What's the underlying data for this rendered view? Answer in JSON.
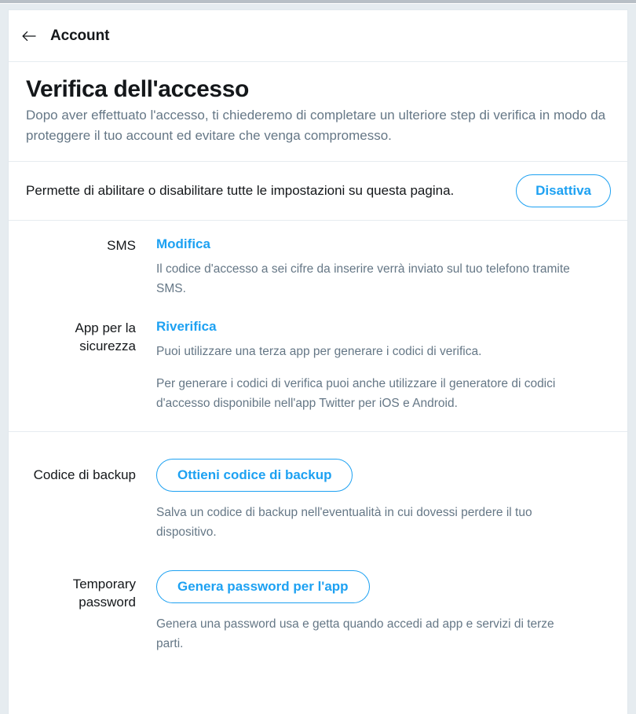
{
  "header": {
    "back_icon": "arrow-left-icon",
    "title": "Account"
  },
  "intro": {
    "title": "Verifica dell'accesso",
    "description": "Dopo aver effettuato l'accesso, ti chiederemo di completare un ulteriore step di verifica in modo da proteggere il tuo account ed evitare che venga compromesso."
  },
  "master": {
    "text": "Permette di abilitare o disabilitare tutte le impostazioni su questa pagina.",
    "button_label": "Disattiva"
  },
  "settings": [
    {
      "label": "SMS",
      "action_type": "link",
      "action_label": "Modifica",
      "descriptions": [
        "Il codice d'accesso a sei cifre da inserire verrà inviato sul tuo telefono tramite SMS."
      ]
    },
    {
      "label": "App per la sicurezza",
      "action_type": "link",
      "action_label": "Riverifica",
      "descriptions": [
        "Puoi utilizzare una terza app per generare i codici di verifica.",
        "Per generare i codici di verifica puoi anche utilizzare il generatore di codici d'accesso disponibile nell'app Twitter per iOS e Android."
      ]
    },
    {
      "label": "Codice di backup",
      "action_type": "button",
      "action_label": "Ottieni codice di backup",
      "descriptions": [
        "Salva un codice di backup nell'eventualità in cui dovessi perdere il tuo dispositivo."
      ]
    },
    {
      "label": "Temporary password",
      "action_type": "button",
      "action_label": "Genera password per l'app",
      "descriptions": [
        "Genera una password usa e getta quando accedi ad app e servizi di terze parti."
      ]
    }
  ],
  "colors": {
    "accent": "#1da1f2",
    "text_primary": "#14171a",
    "text_secondary": "#657786",
    "divider": "#e6ecf0",
    "page_background": "#e6ecf0",
    "card_background": "#ffffff"
  }
}
